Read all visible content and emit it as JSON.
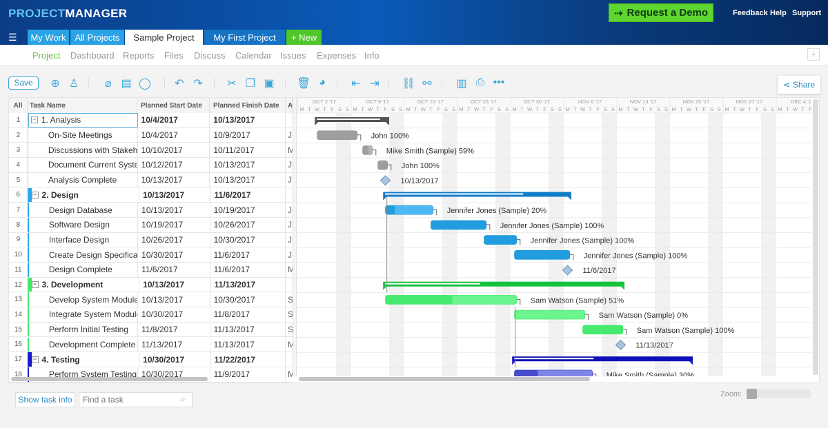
{
  "header": {
    "logo_a": "PROJECT",
    "logo_b": "MANAGER",
    "demo_label": "Request a Demo",
    "links": [
      "Feedback",
      "Help",
      "Support"
    ]
  },
  "tabs": [
    {
      "label": "My Work"
    },
    {
      "label": "All Projects"
    },
    {
      "label": "Sample Project",
      "active": true
    },
    {
      "label": "My First Project"
    },
    {
      "label": "+ New"
    }
  ],
  "subnav": [
    "Project",
    "Dashboard",
    "Reports",
    "Files",
    "Discuss",
    "Calendar",
    "Issues",
    "Expenses",
    "Info"
  ],
  "subnav_active": "Project",
  "toolbar": {
    "save_label": "Save",
    "share_label": "Share"
  },
  "grid": {
    "headers": {
      "all": "All",
      "task": "Task Name",
      "start": "Planned Start Date",
      "finish": "Planned Finish Date",
      "assigned": "A"
    }
  },
  "colors": {
    "analysis": "#a8a8a8",
    "design": "#2aa8ec",
    "development": "#3ee86a",
    "testing": "#1a1acc",
    "accent": "#3aa6d8"
  },
  "gantt": {
    "weeks": [
      "OCT 2 '17",
      "OCT 9 '17",
      "OCT 16 '17",
      "OCT 23 '17",
      "OCT 30 '17",
      "NOV 6 '17",
      "NOV 13 '17",
      "NOV 20 '17",
      "NOV 27 '17",
      "DEC 4 '17"
    ],
    "days": [
      "M",
      "T",
      "W",
      "T",
      "F",
      "S",
      "S"
    ]
  },
  "tasks": [
    {
      "n": "1",
      "name": "1. Analysis",
      "start": "10/4/2017",
      "finish": "10/13/2017",
      "a": "",
      "type": "summary",
      "group": "analysis",
      "progress": 90
    },
    {
      "n": "2",
      "name": "On-Site Meetings",
      "start": "10/4/2017",
      "finish": "10/9/2017",
      "a": "J",
      "type": "task",
      "group": "analysis",
      "resource": "John",
      "progress": 100
    },
    {
      "n": "3",
      "name": "Discussions with Stakeho",
      "start": "10/10/2017",
      "finish": "10/11/2017",
      "a": "M",
      "type": "task",
      "group": "analysis",
      "resource": "Mike Smith (Sample)",
      "progress": 59
    },
    {
      "n": "4",
      "name": "Document Current Syster",
      "start": "10/12/2017",
      "finish": "10/13/2017",
      "a": "J",
      "type": "task",
      "group": "analysis",
      "resource": "John",
      "progress": 100
    },
    {
      "n": "5",
      "name": "Analysis Complete",
      "start": "10/13/2017",
      "finish": "10/13/2017",
      "a": "J",
      "type": "milestone",
      "group": "analysis"
    },
    {
      "n": "6",
      "name": "2. Design",
      "start": "10/13/2017",
      "finish": "11/6/2017",
      "a": "",
      "type": "summary",
      "group": "design",
      "progress": 75
    },
    {
      "n": "7",
      "name": "Design Database",
      "start": "10/13/2017",
      "finish": "10/19/2017",
      "a": "J",
      "type": "task",
      "group": "design",
      "resource": "Jennifer Jones (Sample)",
      "progress": 20
    },
    {
      "n": "8",
      "name": "Software Design",
      "start": "10/19/2017",
      "finish": "10/26/2017",
      "a": "J",
      "type": "task",
      "group": "design",
      "resource": "Jennifer Jones (Sample)",
      "progress": 100
    },
    {
      "n": "9",
      "name": "Interface Design",
      "start": "10/26/2017",
      "finish": "10/30/2017",
      "a": "J",
      "type": "task",
      "group": "design",
      "resource": "Jennifer Jones (Sample)",
      "progress": 100
    },
    {
      "n": "10",
      "name": "Create Design Specificati",
      "start": "10/30/2017",
      "finish": "11/6/2017",
      "a": "J",
      "type": "task",
      "group": "design",
      "resource": "Jennifer Jones (Sample)",
      "progress": 100
    },
    {
      "n": "11",
      "name": "Design Complete",
      "start": "11/6/2017",
      "finish": "11/6/2017",
      "a": "M",
      "type": "milestone",
      "group": "design"
    },
    {
      "n": "12",
      "name": "3. Development",
      "start": "10/13/2017",
      "finish": "11/13/2017",
      "a": "",
      "type": "summary",
      "group": "development",
      "progress": 40
    },
    {
      "n": "13",
      "name": "Develop System Modules",
      "start": "10/13/2017",
      "finish": "10/30/2017",
      "a": "S",
      "type": "task",
      "group": "development",
      "resource": "Sam Watson (Sample)",
      "progress": 51
    },
    {
      "n": "14",
      "name": "Integrate System Module",
      "start": "10/30/2017",
      "finish": "11/8/2017",
      "a": "S",
      "type": "task",
      "group": "development",
      "resource": "Sam Watson (Sample)",
      "progress": 0
    },
    {
      "n": "15",
      "name": "Perform Initial Testing",
      "start": "11/8/2017",
      "finish": "11/13/2017",
      "a": "S",
      "type": "task",
      "group": "development",
      "resource": "Sam Watson (Sample)",
      "progress": 100
    },
    {
      "n": "16",
      "name": "Development Complete",
      "start": "11/13/2017",
      "finish": "11/13/2017",
      "a": "M",
      "type": "milestone",
      "group": "development"
    },
    {
      "n": "17",
      "name": "4. Testing",
      "start": "10/30/2017",
      "finish": "11/22/2017",
      "a": "",
      "type": "summary",
      "group": "testing",
      "progress": 45
    },
    {
      "n": "18",
      "name": "Perform System Testing",
      "start": "10/30/2017",
      "finish": "11/9/2017",
      "a": "M",
      "type": "task",
      "group": "testing",
      "resource": "Mike Smith (Sample)",
      "progress": 30
    }
  ],
  "footer": {
    "show_task_info": "Show task info",
    "find_placeholder": "Find a task",
    "zoom_label": "Zoom:"
  }
}
